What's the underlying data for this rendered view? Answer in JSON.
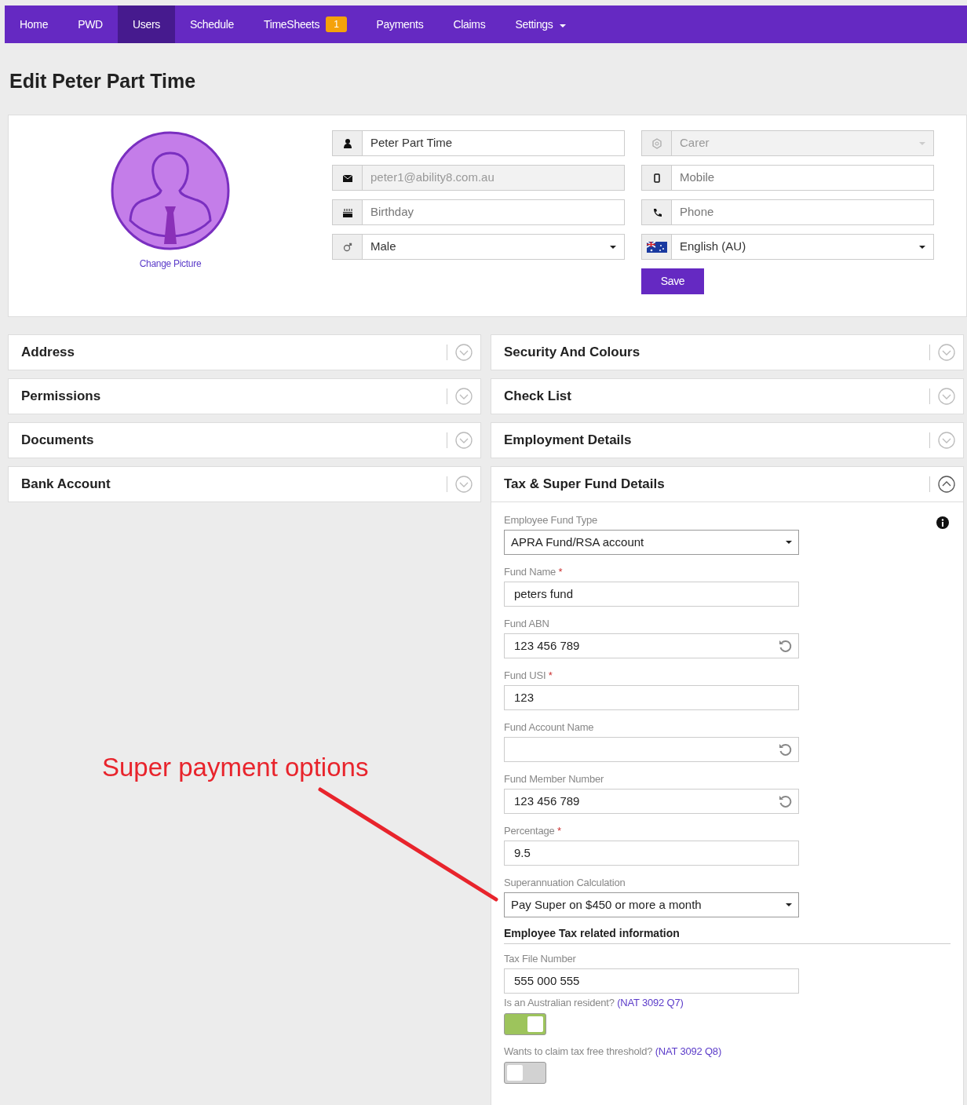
{
  "nav": [
    {
      "label": "Home",
      "selected": false
    },
    {
      "label": "PWD",
      "selected": false
    },
    {
      "label": "Users",
      "selected": true
    },
    {
      "label": "Schedule",
      "selected": false
    },
    {
      "label": "TimeSheets",
      "selected": false,
      "badge": "1"
    },
    {
      "label": "Payments",
      "selected": false
    },
    {
      "label": "Claims",
      "selected": false
    },
    {
      "label": "Settings",
      "selected": false,
      "dropdown": true
    }
  ],
  "page_title": "Edit Peter Part Time",
  "profile": {
    "change_picture": "Change Picture",
    "left_fields": [
      {
        "kind": "text",
        "value": "Peter Part Time",
        "disabled": false
      },
      {
        "kind": "text",
        "value": "peter1@ability8.com.au",
        "disabled": true
      },
      {
        "kind": "text",
        "placeholder": "Birthday",
        "disabled": false
      },
      {
        "kind": "select",
        "value": "Male",
        "disabled": false
      }
    ],
    "right_fields": [
      {
        "kind": "select",
        "value": "Carer",
        "disabled": true
      },
      {
        "kind": "text",
        "placeholder": "Mobile",
        "disabled": false
      },
      {
        "kind": "text",
        "placeholder": "Phone",
        "disabled": false
      },
      {
        "kind": "select",
        "value": "English (AU)",
        "disabled": false
      }
    ],
    "save": "Save"
  },
  "panels_left": [
    {
      "title": "Address",
      "expanded": false
    },
    {
      "title": "Permissions",
      "expanded": false
    },
    {
      "title": "Documents",
      "expanded": false
    },
    {
      "title": "Bank Account",
      "expanded": false
    }
  ],
  "panels_right": [
    {
      "title": "Security And Colours",
      "expanded": false
    },
    {
      "title": "Check List",
      "expanded": false
    },
    {
      "title": "Employment Details",
      "expanded": false
    },
    {
      "title": "Tax & Super Fund Details",
      "expanded": true
    }
  ],
  "tax_super": {
    "fields": [
      {
        "label": "Employee Fund Type",
        "kind": "select",
        "value": "APRA Fund/RSA account",
        "reset": false
      },
      {
        "label": "Fund Name",
        "required_mark": "*",
        "kind": "text",
        "value": "peters fund",
        "reset": false
      },
      {
        "label": "Fund ABN",
        "kind": "text",
        "value": "123 456 789",
        "reset": true
      },
      {
        "label": "Fund USI",
        "required_mark": "*",
        "kind": "text",
        "value": "123",
        "reset": false
      },
      {
        "label": "Fund Account Name",
        "kind": "text",
        "reset": true
      },
      {
        "label": "Fund Member Number",
        "kind": "text",
        "value": "123 456 789",
        "reset": true
      },
      {
        "label": "Percentage",
        "required_mark": "*",
        "kind": "text",
        "value": "9.5",
        "reset": false
      },
      {
        "label": "Superannuation Calculation",
        "kind": "select",
        "value": "Pay Super on $450 or more a month",
        "reset": false
      }
    ],
    "tax_heading": "Employee Tax related information",
    "tax_fields": [
      {
        "label": "Tax File Number",
        "kind": "text",
        "value": "555 000 555",
        "reset": false
      }
    ],
    "toggles": [
      {
        "label": "Is an Australian resident?",
        "link": "(NAT 3092 Q7)",
        "on": true
      },
      {
        "label": "Wants to claim tax free threshold?",
        "link": "(NAT 3092 Q8)",
        "on": false
      }
    ]
  },
  "annotation": {
    "text": "Super payment options"
  }
}
